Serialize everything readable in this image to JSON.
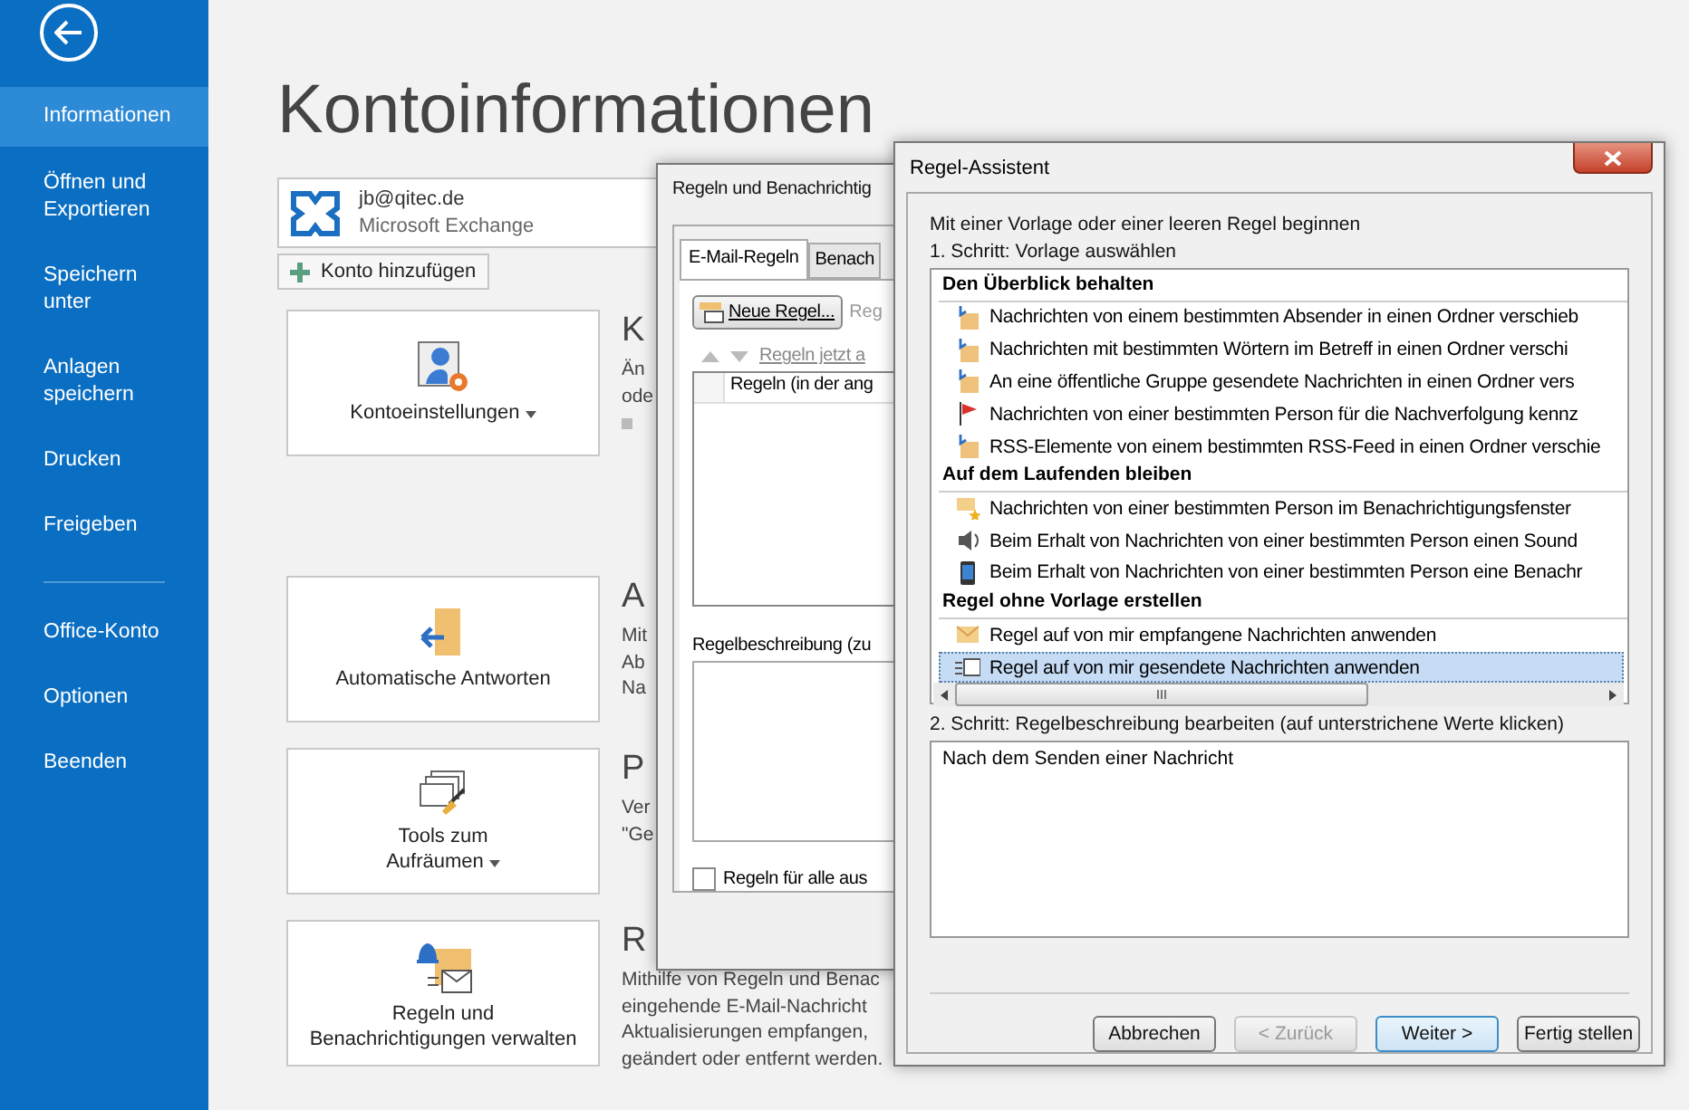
{
  "sidebar": {
    "groups": [
      [
        {
          "label": "Informationen",
          "selected": true
        },
        {
          "label": "Öffnen und Exportieren",
          "selected": false
        },
        {
          "label": "Speichern unter",
          "selected": false
        },
        {
          "label": "Anlagen speichern",
          "selected": false
        },
        {
          "label": "Drucken",
          "selected": false
        },
        {
          "label": "Freigeben",
          "selected": false
        }
      ],
      [
        {
          "label": "Office-Konto",
          "selected": false
        },
        {
          "label": "Optionen",
          "selected": false
        },
        {
          "label": "Beenden",
          "selected": false
        }
      ]
    ]
  },
  "page_title": "Kontoinformationen",
  "account": {
    "email": "jb@qitec.de",
    "type": "Microsoft Exchange"
  },
  "add_account_button": "Konto hinzufügen",
  "sections": [
    {
      "button_lines": [
        "Kontoeinstellungen"
      ],
      "dropdown": true,
      "heading": "K",
      "lines": [
        "Än",
        "ode"
      ],
      "bullet": true
    },
    {
      "button_lines": [
        "Automatische Antworten"
      ],
      "dropdown": false,
      "heading": "A",
      "lines": [
        "Mit",
        "Ab",
        "Na"
      ],
      "bullet": false
    },
    {
      "button_lines": [
        "Tools zum",
        "Aufräumen"
      ],
      "dropdown": true,
      "heading": "P",
      "lines": [
        "Ver",
        "\"Ge"
      ],
      "bullet": false
    },
    {
      "button_lines": [
        "Regeln und",
        "Benachrichtigungen verwalten"
      ],
      "dropdown": false,
      "heading": "R",
      "lines": [
        "Mithilfe von Regeln und Benac",
        "eingehende E-Mail-Nachricht",
        "Aktualisierungen empfangen,",
        "geändert oder entfernt werden."
      ],
      "bullet": false
    }
  ],
  "rules_dialog": {
    "title": "Regeln und Benachrichtig",
    "tabs": [
      {
        "label": "E-Mail-Regeln",
        "selected": true
      },
      {
        "label": "Benach",
        "selected": false
      }
    ],
    "new_rule_button": "Neue Regel...",
    "toolbar_text": "Reg",
    "run_rules_link": "Regeln jetzt a",
    "list_header": "Regeln (in der ang",
    "description_label": "Regelbeschreibung (zu",
    "apply_all": {
      "label": "Regeln für alle aus",
      "checked": false
    }
  },
  "wizard": {
    "title": "Regel-Assistent",
    "intro": "Mit einer Vorlage oder einer leeren Regel beginnen",
    "step1": "1. Schritt: Vorlage auswählen",
    "templates": [
      {
        "kind": "header",
        "label": "Den Überblick behalten"
      },
      {
        "kind": "item",
        "label": "Nachrichten von einem bestimmten Absender in einen Ordner verschieb",
        "selected": false
      },
      {
        "kind": "item",
        "label": "Nachrichten mit bestimmten Wörtern im Betreff in einen Ordner verschi",
        "selected": false
      },
      {
        "kind": "item",
        "label": "An eine öffentliche Gruppe gesendete Nachrichten in einen Ordner vers",
        "selected": false
      },
      {
        "kind": "item",
        "label": "Nachrichten von einer bestimmten Person für die Nachverfolgung kennz",
        "selected": false
      },
      {
        "kind": "item",
        "label": "RSS-Elemente von einem bestimmten RSS-Feed in einen Ordner verschie",
        "selected": false
      },
      {
        "kind": "header",
        "label": "Auf dem Laufenden bleiben"
      },
      {
        "kind": "item",
        "label": "Nachrichten von einer bestimmten Person im Benachrichtigungsfenster",
        "selected": false
      },
      {
        "kind": "item",
        "label": "Beim Erhalt von Nachrichten von einer bestimmten Person einen Sound",
        "selected": false
      },
      {
        "kind": "item",
        "label": "Beim Erhalt von Nachrichten von einer bestimmten Person eine Benachr",
        "selected": false
      },
      {
        "kind": "header",
        "label": "Regel ohne Vorlage erstellen"
      },
      {
        "kind": "item",
        "label": "Regel auf von mir empfangene Nachrichten anwenden",
        "selected": false
      },
      {
        "kind": "item",
        "label": "Regel auf von mir gesendete Nachrichten anwenden",
        "selected": true
      }
    ],
    "step2": "2. Schritt: Regelbeschreibung bearbeiten (auf unterstrichene Werte klicken)",
    "description": "Nach dem Senden einer Nachricht",
    "buttons": [
      {
        "label": "Abbrechen",
        "disabled": false,
        "default": false
      },
      {
        "label": "< Zurück",
        "disabled": true,
        "default": false
      },
      {
        "label": "Weiter >",
        "disabled": false,
        "default": true
      },
      {
        "label": "Fertig stellen",
        "disabled": false,
        "default": false
      }
    ]
  }
}
